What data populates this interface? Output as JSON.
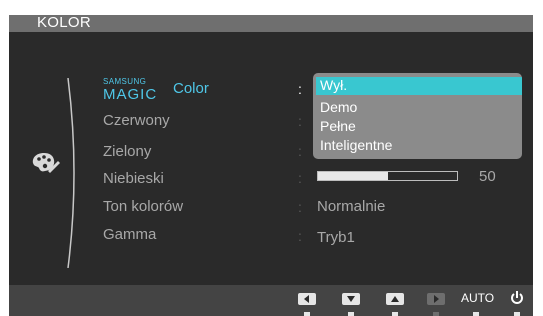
{
  "title": "KOLOR",
  "magic_color": {
    "samsung": "SAMSUNG",
    "magic": "MAGIC",
    "color": "Color"
  },
  "menu": [
    {
      "label": "Czerwony"
    },
    {
      "label": "Zielony"
    },
    {
      "label": "Niebieski"
    },
    {
      "label": "Ton kolorów"
    },
    {
      "label": "Gamma"
    }
  ],
  "colon": ":",
  "dropdown": {
    "options": [
      "Wył.",
      "Demo",
      "Pełne",
      "Inteligentne"
    ],
    "selected": "Wył."
  },
  "niebieski": {
    "value": "50",
    "fraction": 0.5
  },
  "ton_kolorow_value": "Normalnie",
  "gamma_value": "Tryb1",
  "bottom": {
    "auto_label": "AUTO"
  },
  "icons": [
    "palette-icon",
    "left-arrow-icon",
    "down-arrow-icon",
    "up-arrow-icon",
    "enter-icon",
    "power-icon"
  ],
  "colors": {
    "accent": "#39c7d0",
    "magic_blue": "#4fc7e8",
    "panel": "#2a2a2a",
    "title_bar": "#6f6f6f"
  }
}
